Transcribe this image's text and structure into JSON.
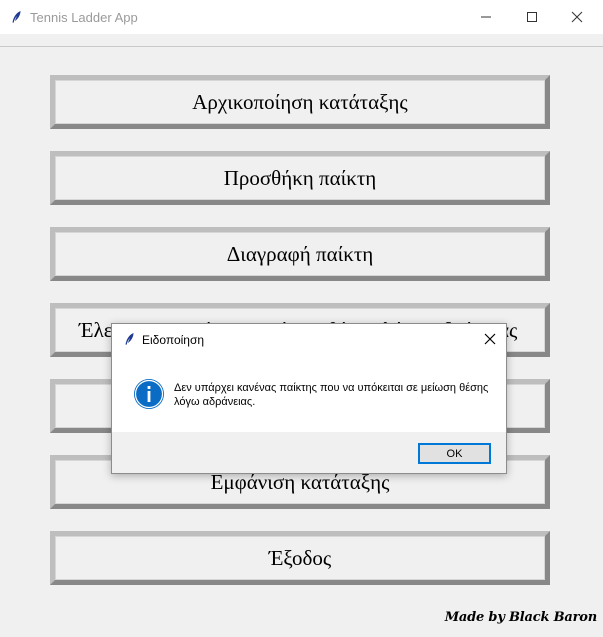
{
  "window": {
    "title": "Tennis Ladder App",
    "icon": "feather-icon",
    "controls": [
      "minimize-icon",
      "maximize-icon",
      "close-icon"
    ]
  },
  "menu": {
    "buttons": [
      "Αρχικοποίηση κατάταξης",
      "Προσθήκη παίκτη",
      "Διαγραφή παίκτη",
      "Έλεγχος παικτών για μείωση θέσης λόγω αδράνειας",
      "",
      "Εμφάνιση κατάταξης",
      "Έξοδος"
    ]
  },
  "credit": "Made by Black Baron",
  "dialog": {
    "title": "Ειδοποίηση",
    "icon": "info-icon",
    "message": "Δεν υπάρχει κανένας παίκτης που να υπόκειται σε μείωση θέσης λόγω αδράνειας.",
    "ok_label": "OK"
  },
  "colors": {
    "background": "#f0f0f0",
    "info_blue": "#0a6cc4",
    "focus_blue": "#0078d7"
  }
}
